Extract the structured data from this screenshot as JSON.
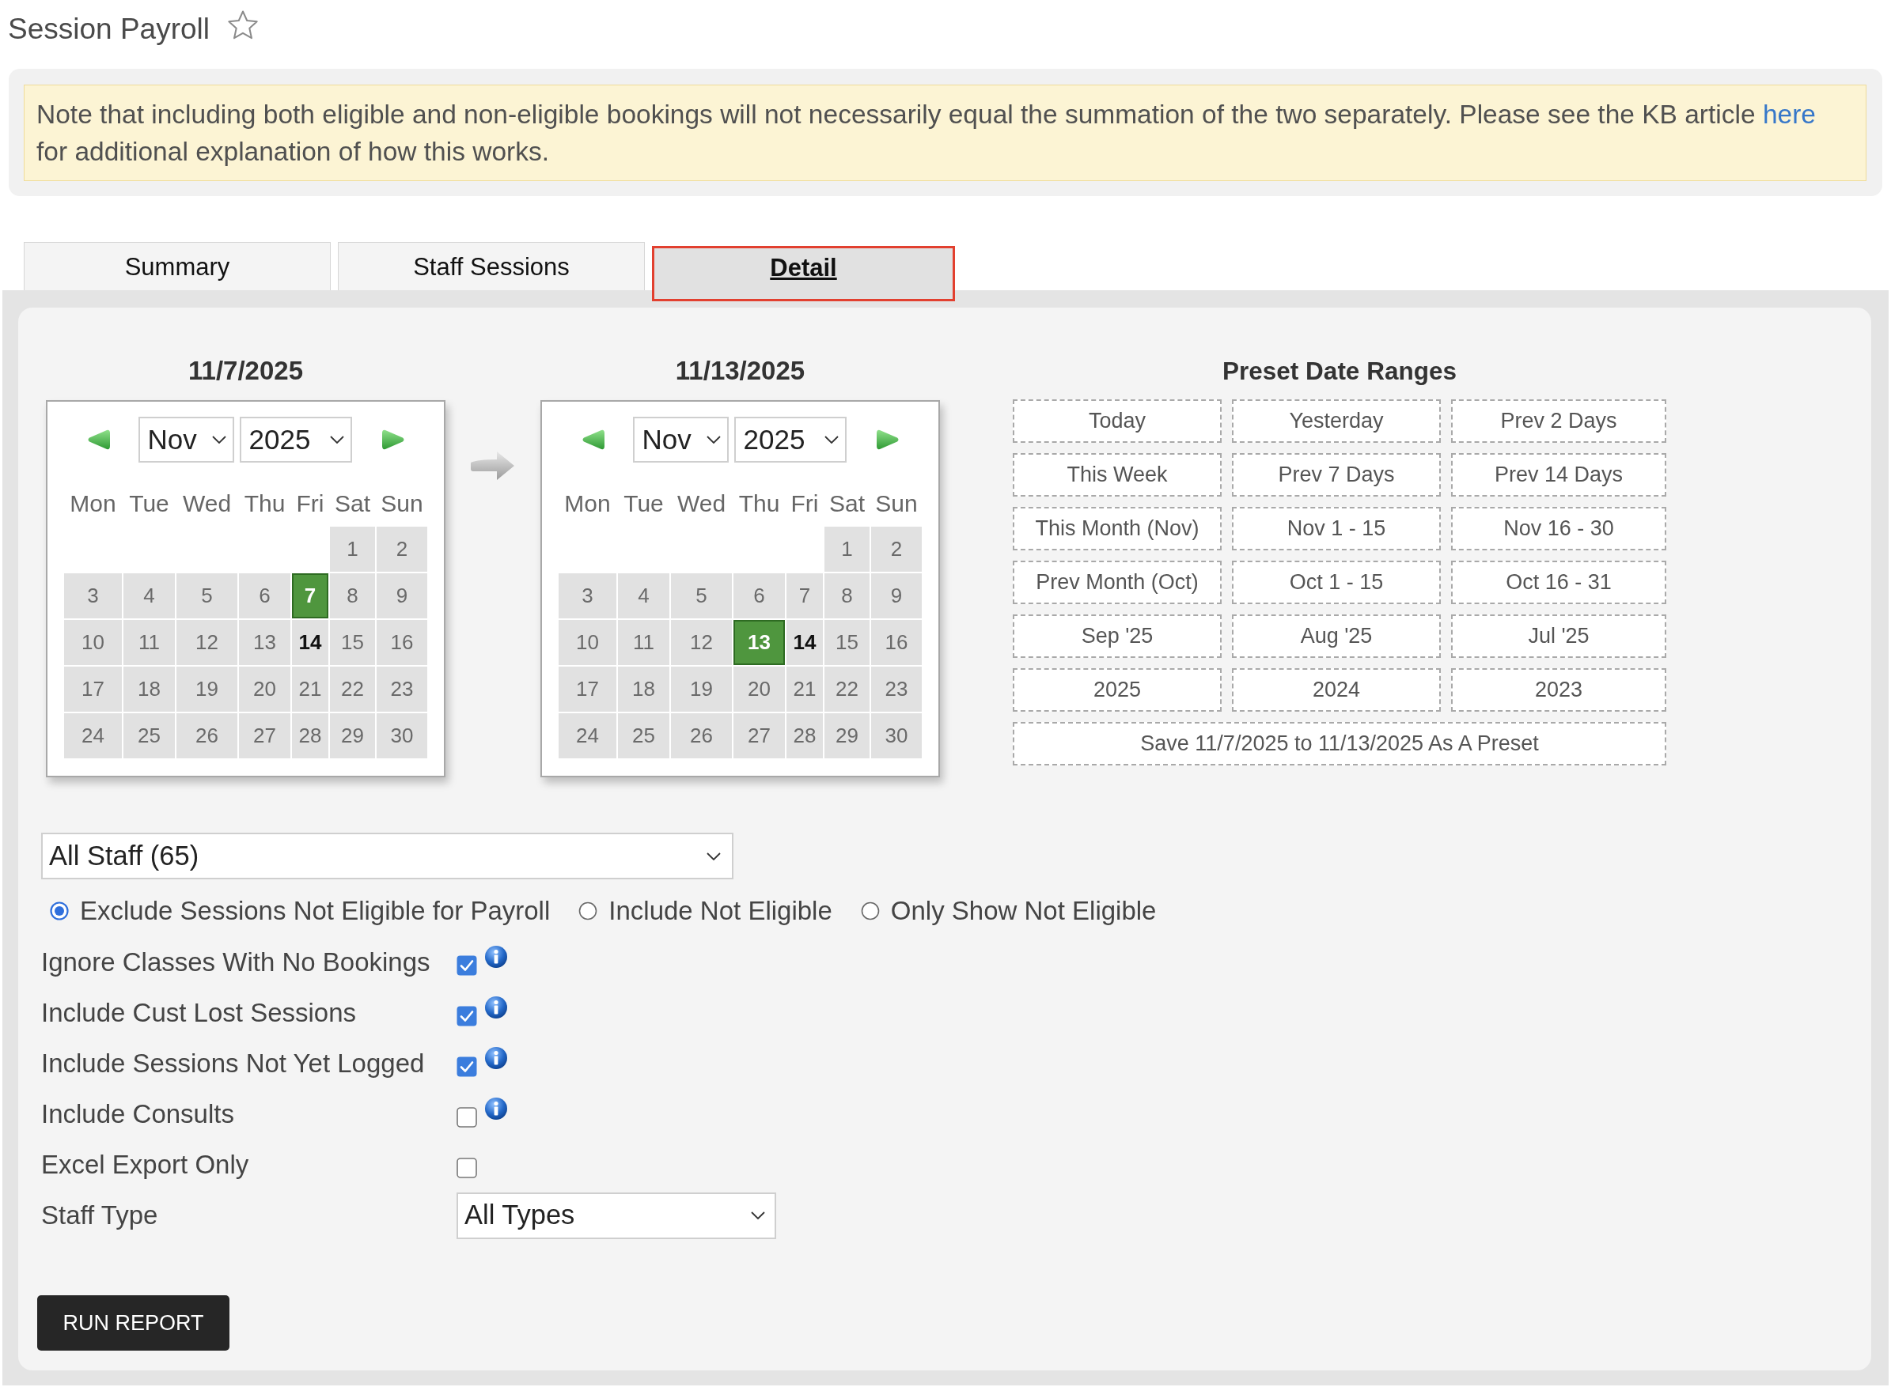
{
  "page": {
    "title": "Session Payroll",
    "starred": false
  },
  "notice": {
    "text": "Note that including both eligible and non-eligible bookings will not necessarily equal the summation of the two separately. Please see the KB article",
    "link": "here",
    "text_after": "for additional explanation of how this works."
  },
  "tabs": [
    {
      "label": "Summary",
      "selected": false
    },
    {
      "label": "Staff Sessions",
      "selected": false
    },
    {
      "label": "Detail",
      "selected": true
    }
  ],
  "calendars": [
    {
      "heading": "11/7/2025",
      "month": "Nov",
      "year": "2025",
      "weekdays": [
        "Mon",
        "Tue",
        "Wed",
        "Thu",
        "Fri",
        "Sat",
        "Sun"
      ],
      "weeks": [
        [
          {
            "day": "1",
            "selected": false,
            "today": false
          },
          {
            "day": "2",
            "selected": false,
            "today": false
          }
        ],
        [
          {
            "day": "3",
            "selected": false,
            "today": false
          },
          {
            "day": "4",
            "selected": false,
            "today": false
          },
          {
            "day": "5",
            "selected": false,
            "today": false
          },
          {
            "day": "6",
            "selected": false,
            "today": false
          },
          {
            "day": "7",
            "selected": true,
            "today": false
          },
          {
            "day": "8",
            "selected": false,
            "today": false
          },
          {
            "day": "9",
            "selected": false,
            "today": false
          }
        ],
        [
          {
            "day": "10",
            "selected": false,
            "today": false
          },
          {
            "day": "11",
            "selected": false,
            "today": false
          },
          {
            "day": "12",
            "selected": false,
            "today": false
          },
          {
            "day": "13",
            "selected": false,
            "today": false
          },
          {
            "day": "14",
            "selected": false,
            "today": true
          },
          {
            "day": "15",
            "selected": false,
            "today": false
          },
          {
            "day": "16",
            "selected": false,
            "today": false
          }
        ],
        [
          {
            "day": "17",
            "selected": false,
            "today": false
          },
          {
            "day": "18",
            "selected": false,
            "today": false
          },
          {
            "day": "19",
            "selected": false,
            "today": false
          },
          {
            "day": "20",
            "selected": false,
            "today": false
          },
          {
            "day": "21",
            "selected": false,
            "today": false
          },
          {
            "day": "22",
            "selected": false,
            "today": false
          },
          {
            "day": "23",
            "selected": false,
            "today": false
          }
        ],
        [
          {
            "day": "24",
            "selected": false,
            "today": false
          },
          {
            "day": "25",
            "selected": false,
            "today": false
          },
          {
            "day": "26",
            "selected": false,
            "today": false
          },
          {
            "day": "27",
            "selected": false,
            "today": false
          },
          {
            "day": "28",
            "selected": false,
            "today": false
          },
          {
            "day": "29",
            "selected": false,
            "today": false
          },
          {
            "day": "30",
            "selected": false,
            "today": false
          }
        ]
      ]
    },
    {
      "heading": "11/13/2025",
      "month": "Nov",
      "year": "2025",
      "weekdays": [
        "Mon",
        "Tue",
        "Wed",
        "Thu",
        "Fri",
        "Sat",
        "Sun"
      ],
      "weeks": [
        [
          {
            "day": "1",
            "selected": false,
            "today": false
          },
          {
            "day": "2",
            "selected": false,
            "today": false
          }
        ],
        [
          {
            "day": "3",
            "selected": false,
            "today": false
          },
          {
            "day": "4",
            "selected": false,
            "today": false
          },
          {
            "day": "5",
            "selected": false,
            "today": false
          },
          {
            "day": "6",
            "selected": false,
            "today": false
          },
          {
            "day": "7",
            "selected": false,
            "today": false
          },
          {
            "day": "8",
            "selected": false,
            "today": false
          },
          {
            "day": "9",
            "selected": false,
            "today": false
          }
        ],
        [
          {
            "day": "10",
            "selected": false,
            "today": false
          },
          {
            "day": "11",
            "selected": false,
            "today": false
          },
          {
            "day": "12",
            "selected": false,
            "today": false
          },
          {
            "day": "13",
            "selected": true,
            "today": false
          },
          {
            "day": "14",
            "selected": false,
            "today": true
          },
          {
            "day": "15",
            "selected": false,
            "today": false
          },
          {
            "day": "16",
            "selected": false,
            "today": false
          }
        ],
        [
          {
            "day": "17",
            "selected": false,
            "today": false
          },
          {
            "day": "18",
            "selected": false,
            "today": false
          },
          {
            "day": "19",
            "selected": false,
            "today": false
          },
          {
            "day": "20",
            "selected": false,
            "today": false
          },
          {
            "day": "21",
            "selected": false,
            "today": false
          },
          {
            "day": "22",
            "selected": false,
            "today": false
          },
          {
            "day": "23",
            "selected": false,
            "today": false
          }
        ],
        [
          {
            "day": "24",
            "selected": false,
            "today": false
          },
          {
            "day": "25",
            "selected": false,
            "today": false
          },
          {
            "day": "26",
            "selected": false,
            "today": false
          },
          {
            "day": "27",
            "selected": false,
            "today": false
          },
          {
            "day": "28",
            "selected": false,
            "today": false
          },
          {
            "day": "29",
            "selected": false,
            "today": false
          },
          {
            "day": "30",
            "selected": false,
            "today": false
          }
        ]
      ]
    }
  ],
  "presets": {
    "heading": "Preset Date Ranges",
    "items": [
      "Today",
      "Yesterday",
      "Prev 2 Days",
      "This Week",
      "Prev 7 Days",
      "Prev 14 Days",
      "This Month (Nov)",
      "Nov 1 - 15",
      "Nov 16 - 30",
      "Prev Month (Oct)",
      "Oct 1 - 15",
      "Oct 16 - 31",
      "Sep '25",
      "Aug '25",
      "Jul '25",
      "2025",
      "2024",
      "2023"
    ],
    "save_button": "Save 11/7/2025 to 11/13/2025 As A Preset"
  },
  "staff_select": {
    "value": "All Staff (65)"
  },
  "eligibility": [
    {
      "label": "Exclude Sessions Not Eligible for Payroll",
      "selected": true
    },
    {
      "label": "Include Not Eligible",
      "selected": false
    },
    {
      "label": "Only Show Not Eligible",
      "selected": false
    }
  ],
  "options": [
    {
      "kind": "checkbox",
      "label": "Ignore Classes With No Bookings",
      "checked": true,
      "info": true
    },
    {
      "kind": "checkbox",
      "label": "Include Cust Lost Sessions",
      "checked": true,
      "info": true
    },
    {
      "kind": "checkbox",
      "label": "Include Sessions Not Yet Logged",
      "checked": true,
      "info": true
    },
    {
      "kind": "checkbox",
      "label": "Include Consults",
      "checked": false,
      "info": true
    },
    {
      "kind": "checkbox",
      "label": "Excel Export Only",
      "checked": false,
      "info": false
    },
    {
      "kind": "select",
      "label": "Staff Type",
      "value": "All Types"
    }
  ],
  "run_button": "RUN REPORT"
}
